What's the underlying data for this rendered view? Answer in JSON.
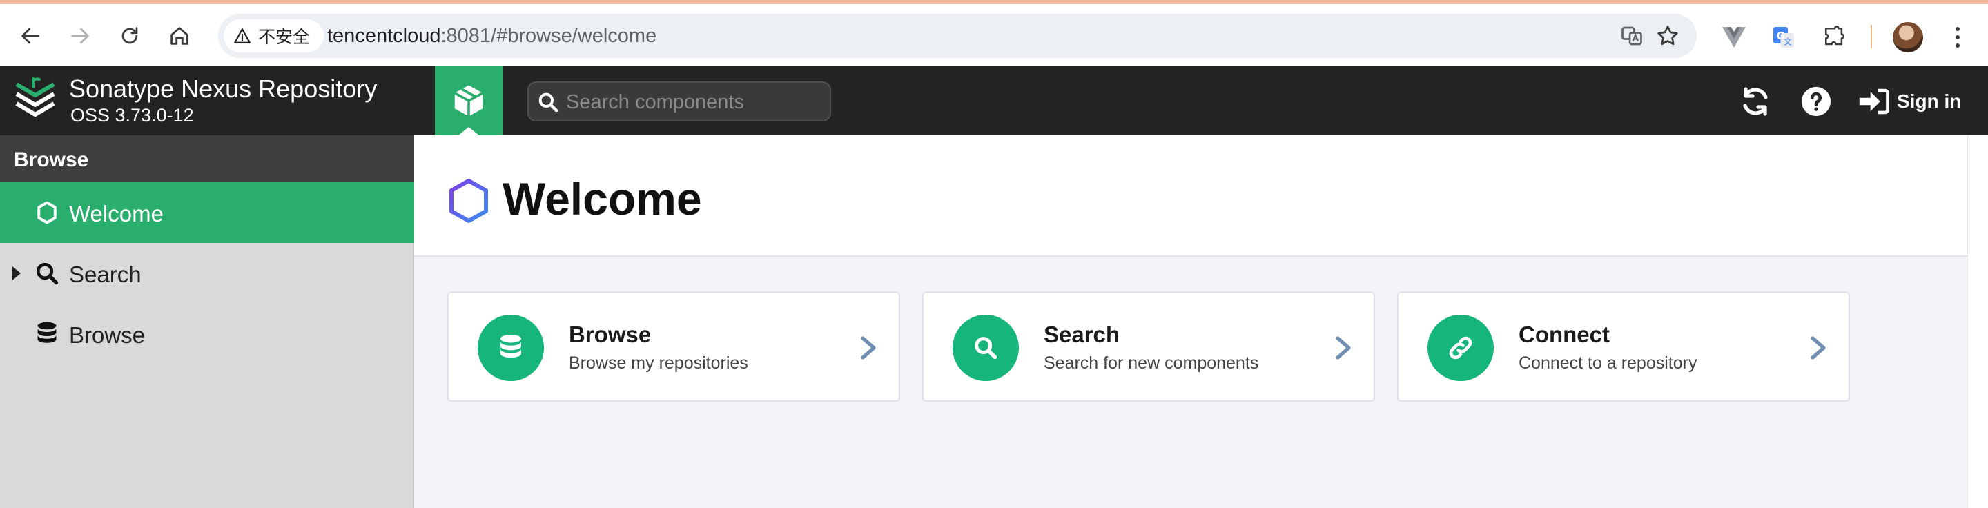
{
  "browser": {
    "security_label": "不安全",
    "url_host": "tencentcloud",
    "url_rest": ":8081/#browse/welcome"
  },
  "app": {
    "title": "Sonatype Nexus Repository",
    "version": "OSS 3.73.0-12",
    "search_placeholder": "Search components",
    "signin_label": "Sign in"
  },
  "sidebar": {
    "heading": "Browse",
    "items": [
      {
        "label": "Welcome",
        "icon": "hexagon-icon",
        "active": true
      },
      {
        "label": "Search",
        "icon": "search-icon",
        "active": false
      },
      {
        "label": "Browse",
        "icon": "database-icon",
        "active": false
      }
    ]
  },
  "main": {
    "title": "Welcome",
    "cards": [
      {
        "title": "Browse",
        "description": "Browse my repositories",
        "icon": "database-icon"
      },
      {
        "title": "Search",
        "description": "Search for new components",
        "icon": "search-icon"
      },
      {
        "title": "Connect",
        "description": "Connect to a repository",
        "icon": "link-icon"
      }
    ]
  },
  "colors": {
    "accent_green": "#2aae6d",
    "card_icon_green": "#16b57b",
    "header_dark": "#232323",
    "sidebar_bg": "#d9d9d9"
  }
}
